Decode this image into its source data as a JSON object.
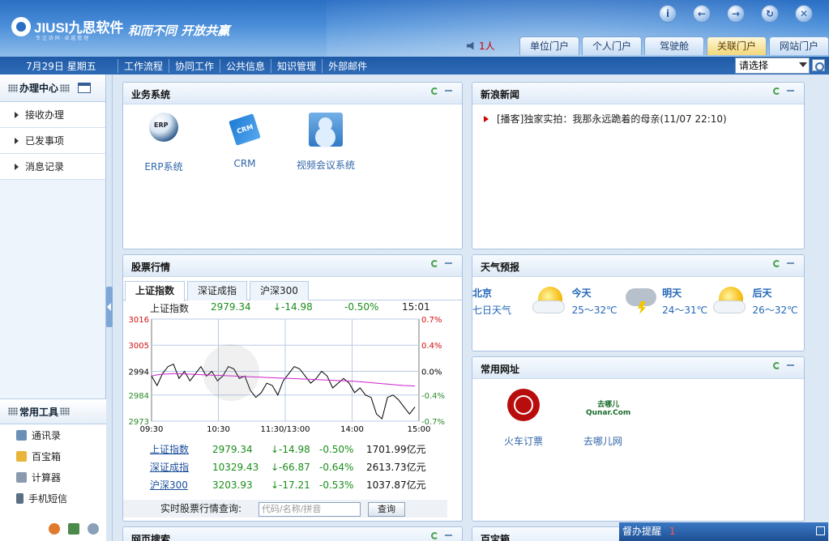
{
  "header": {
    "logo_text": "JIUSI九思软件",
    "logo_sub": "专 注 协 同 · 卓 越 管 理",
    "slogan": "和而不同 开放共赢",
    "online_count": "1人",
    "top_icons": [
      "info-icon",
      "back-icon",
      "forward-icon",
      "refresh-icon",
      "close-icon"
    ],
    "tabs": [
      "单位门户",
      "个人门户",
      "驾驶舱",
      "关联门户",
      "网站门户"
    ],
    "active_tab": "关联门户"
  },
  "navbar": {
    "date": "7月29日  星期五",
    "menu": [
      "工作流程",
      "协同工作",
      "公共信息",
      "知识管理",
      "外部邮件"
    ],
    "select_value": "请选择"
  },
  "sidebar": {
    "title": "办理中心",
    "items": [
      "接收办理",
      "已发事项",
      "消息记录"
    ],
    "tools_title": "常用工具",
    "tools": [
      {
        "label": "通讯录",
        "icon": "address-book-icon"
      },
      {
        "label": "百宝箱",
        "icon": "toolbox-icon"
      },
      {
        "label": "计算器",
        "icon": "calculator-icon"
      },
      {
        "label": "手机短信",
        "icon": "mobile-sms-icon"
      }
    ]
  },
  "business": {
    "title": "业务系统",
    "apps": [
      {
        "label": "ERP系统",
        "icon": "erp-icon"
      },
      {
        "label": "CRM",
        "icon": "crm-icon"
      },
      {
        "label": "视频会议系统",
        "icon": "video-conference-icon"
      }
    ]
  },
  "news": {
    "title": "新浪新闻",
    "items": [
      "[播客]独家实拍：我那永远跪着的母亲(11/07 22:10)"
    ]
  },
  "stock": {
    "title": "股票行情",
    "tabs": [
      "上证指数",
      "深证成指",
      "沪深300"
    ],
    "active_tab": "上证指数",
    "quote": {
      "name": "上证指数",
      "price": "2979.34",
      "change": "↓-14.98",
      "pct": "-0.50%",
      "time": "15:01"
    },
    "table": [
      {
        "name": "上证指数",
        "price": "2979.34",
        "change": "↓-14.98",
        "pct": "-0.50%",
        "amount": "1701.99亿元"
      },
      {
        "name": "深证成指",
        "price": "10329.43",
        "change": "↓-66.87",
        "pct": "-0.64%",
        "amount": "2613.73亿元"
      },
      {
        "name": "沪深300",
        "price": "3203.93",
        "change": "↓-17.21",
        "pct": "-0.53%",
        "amount": "1037.87亿元"
      }
    ],
    "query_label": "实时股票行情查询:",
    "query_placeholder": "代码/名称/拼音",
    "query_button": "查询"
  },
  "chart_data": {
    "type": "line",
    "x_ticks": [
      "09:30",
      "10:30",
      "11:30/13:00",
      "14:00",
      "15:00"
    ],
    "y_ticks_left": [
      3016,
      3005,
      2994,
      2984,
      2973
    ],
    "y_ticks_right": [
      "0.7%",
      "0.4%",
      "0.0%",
      "-0.4%",
      "-0.7%"
    ],
    "ylim": [
      2973,
      3016
    ],
    "series": [
      {
        "values": [
          2992,
          2988,
          2993,
          2996,
          2997,
          2991,
          2994,
          2990,
          2993,
          2996,
          2992,
          2994,
          2990,
          2992,
          2996,
          2995,
          2991,
          2992,
          2986,
          2983,
          2985,
          2989,
          2988,
          2984,
          2990,
          2993,
          2996,
          2995,
          2992,
          2989,
          2991,
          2994,
          2992,
          2987,
          2989,
          2991,
          2989,
          2985,
          2987,
          2984,
          2983,
          2976,
          2974,
          2983,
          2984,
          2982,
          2979,
          2976,
          2979
        ],
        "color": "#000000"
      },
      {
        "values": [
          2992,
          2992.5,
          2992.8,
          2992.9,
          2993,
          2993,
          2992.9,
          2992.8,
          2992.7,
          2992.6,
          2992.5,
          2992.4,
          2992.3,
          2992.2,
          2992.1,
          2992,
          2991.9,
          2991.8,
          2991.7,
          2991.6,
          2991.5,
          2991.4,
          2991.3,
          2991.2,
          2991.1,
          2991,
          2990.9,
          2990.8,
          2990.7,
          2990.6,
          2990.5,
          2990.4,
          2990.3,
          2990.2,
          2990.1,
          2990,
          2989.9,
          2989.8,
          2989.6,
          2989.4,
          2989.2,
          2989,
          2988.8,
          2988.6,
          2988.4,
          2988.2,
          2988,
          2987.9,
          2987.8
        ],
        "color": "#d020d0"
      }
    ],
    "grid": true
  },
  "weather": {
    "title": "天气预报",
    "city": "北京",
    "city_sub": "七日天气",
    "days": [
      {
        "day": "今天",
        "temp": "25～32℃",
        "icon": "sunny-cloudy-icon"
      },
      {
        "day": "明天",
        "temp": "24～31℃",
        "icon": "thunderstorm-icon"
      },
      {
        "day": "后天",
        "temp": "26～32℃",
        "icon": "sunny-cloudy-icon"
      }
    ]
  },
  "links": {
    "title": "常用网址",
    "items": [
      {
        "label": "火车订票",
        "icon": "railway-icon"
      },
      {
        "label": "去哪儿网",
        "icon": "qunar-icon",
        "logo_text": "去哪儿 Qunar.Com"
      }
    ]
  },
  "bottom": {
    "search_title": "网页搜索",
    "baibao_title": "百宝箱",
    "reminder": "督办提醒",
    "reminder_count": "1"
  }
}
